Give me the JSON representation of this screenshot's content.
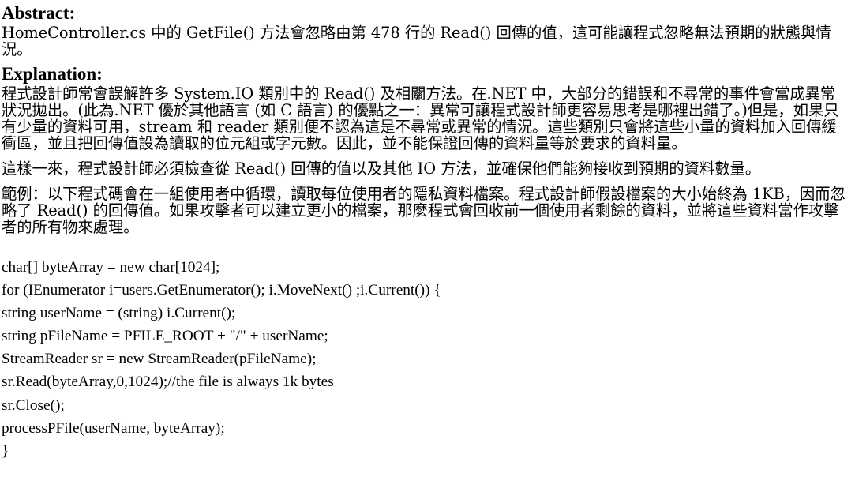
{
  "abstract": {
    "heading": "Abstract:",
    "text": "HomeController.cs 中的 GetFile() 方法會忽略由第 478 行的 Read() 回傳的值，這可能讓程式忽略無法預期的狀態與情況。"
  },
  "explanation": {
    "heading": "Explanation:",
    "paragraphs": [
      "程式設計師常會誤解許多 System.IO 類別中的 Read() 及相關方法。在.NET 中，大部分的錯誤和不尋常的事件會當成異常狀況拋出。(此為.NET 優於其他語言 (如 C 語言) 的優點之一：異常可讓程式設計師更容易思考是哪裡出錯了。)但是，如果只有少量的資料可用，stream 和 reader 類別便不認為這是不尋常或異常的情況。這些類別只會將這些小量的資料加入回傳緩衝區，並且把回傳值設為讀取的位元組或字元數。因此，並不能保證回傳的資料量等於要求的資料量。",
      "這樣一來，程式設計師必須檢查從 Read() 回傳的值以及其他 IO 方法，並確保他們能夠接收到預期的資料數量。",
      "範例：以下程式碼會在一組使用者中循環，讀取每位使用者的隱私資料檔案。程式設計師假設檔案的大小始終為 1KB，因而忽略了 Read() 的回傳值。如果攻擊者可以建立更小的檔案，那麼程式會回收前一個使用者剩餘的資料，並將這些資料當作攻擊者的所有物來處理。"
    ]
  },
  "code": [
    "char[] byteArray = new char[1024];",
    "for (IEnumerator i=users.GetEnumerator(); i.MoveNext() ;i.Current()) {",
    "string userName = (string) i.Current();",
    "string pFileName = PFILE_ROOT + \"/\" + userName;",
    "StreamReader sr = new StreamReader(pFileName);",
    "sr.Read(byteArray,0,1024);//the file is always 1k bytes",
    "sr.Close();",
    "processPFile(userName, byteArray);",
    "}"
  ]
}
